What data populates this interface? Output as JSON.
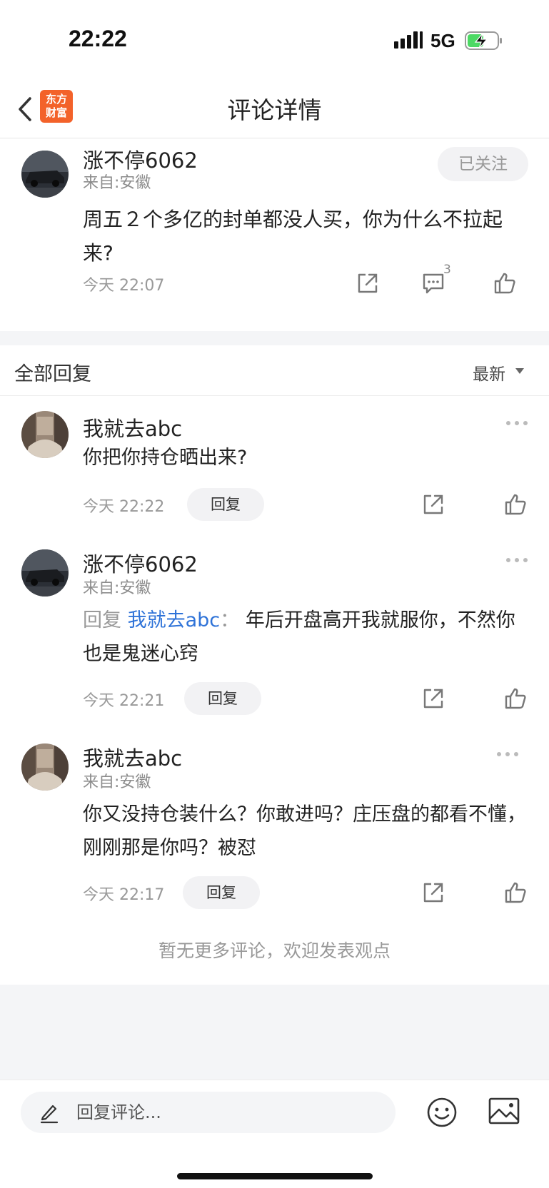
{
  "status_bar": {
    "time": "22:22",
    "network": "5G"
  },
  "header": {
    "title": "评论详情",
    "logo_line1": "东方",
    "logo_line2": "财富"
  },
  "post": {
    "author": "涨不停6062",
    "location": "来自:安徽",
    "follow_label": "已关注",
    "text": "周五２个多亿的封单都没人买，你为什么不拉起来?",
    "time": "今天 22:07",
    "comment_count": "3"
  },
  "replies_section": {
    "title": "全部回复",
    "sort_label": "最新"
  },
  "replies": [
    {
      "author": "我就去abc",
      "text": "你把你持仓晒出来?",
      "time": "今天 22:22",
      "reply_label": "回复"
    },
    {
      "author": "涨不停6062",
      "location": "来自:安徽",
      "reply_prefix": "回复",
      "mention": "我就去abc",
      "separator": "：",
      "text": "年后开盘高开我就服你，不然你也是鬼迷心窍",
      "time": "今天 22:21",
      "reply_label": "回复"
    },
    {
      "author": "我就去abc",
      "location": "来自:安徽",
      "text": "你又没持仓装什么？你敢进吗？庄压盘的都看不懂，刚刚那是你吗？被怼",
      "time": "今天 22:17",
      "reply_label": "回复"
    }
  ],
  "footer_note": "暂无更多评论，欢迎发表观点",
  "bottom_bar": {
    "placeholder": "回复评论..."
  },
  "colors": {
    "brand": "#f3622a",
    "mention": "#2f73d8",
    "muted": "#999999",
    "battery_green": "#4cd964"
  }
}
